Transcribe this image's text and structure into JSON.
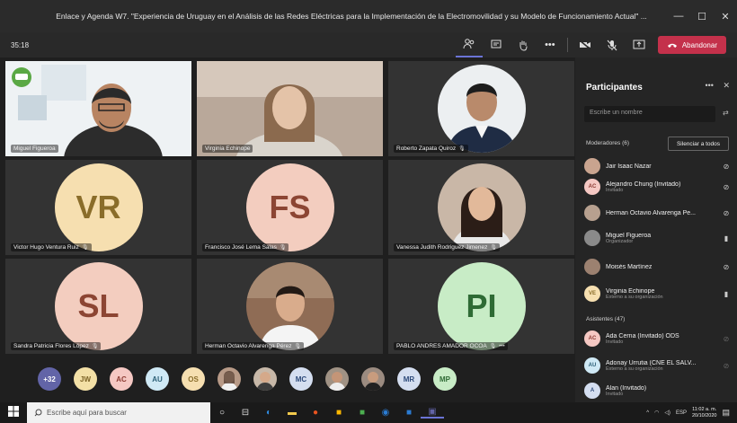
{
  "window": {
    "title": "Enlace y Agenda W7. \"Experiencia de Uruguay en el Análisis de las Redes Eléctricas para la Implementación de la Electromovilidad y su Modelo de Funcionamiento Actual\" ...",
    "minimize": "—",
    "maximize": "☐",
    "close": "✕"
  },
  "toolbar": {
    "timer": "35:18",
    "leave_label": "Abandonar"
  },
  "tiles": [
    {
      "name": "Miguel Figueroa",
      "initials": "",
      "color": "",
      "mic": false
    },
    {
      "name": "Virginia Echinope",
      "initials": "",
      "color": "",
      "mic": false
    },
    {
      "name": "Roberto Zapata Quiroz",
      "initials": "",
      "color": "",
      "mic": true
    },
    {
      "name": "Victor Hugo Ventura Ruiz",
      "initials": "VR",
      "color": "#f6dfb0",
      "mic": true
    },
    {
      "name": "Francisco José Lema Salas",
      "initials": "FS",
      "color": "#f3cdbf",
      "mic": true
    },
    {
      "name": "Vanessa Judith Rodriguez Jimenez",
      "initials": "",
      "color": "",
      "mic": true
    },
    {
      "name": "Sandra Patricia Flores López",
      "initials": "SL",
      "color": "#f3cdbf",
      "mic": true
    },
    {
      "name": "Herman Octavio Alvarenga Pérez",
      "initials": "",
      "color": "",
      "mic": true
    },
    {
      "name": "PABLO ANDRES AMADOR OCOA",
      "initials": "PI",
      "color": "#c8ecc6",
      "mic": true
    }
  ],
  "strip": {
    "overflow": "+32",
    "chips": [
      {
        "label": "JW",
        "color": "#f3e0a6"
      },
      {
        "label": "AC",
        "color": "#f5c8c3"
      },
      {
        "label": "AU",
        "color": "#cfe9f5"
      },
      {
        "label": "OS",
        "color": "#f6dfb0"
      },
      {
        "label": "",
        "color": "#b89a87"
      },
      {
        "label": "",
        "color": "#c7b8a8"
      },
      {
        "label": "MC",
        "color": "#d4def0"
      },
      {
        "label": "",
        "color": "#a09284"
      },
      {
        "label": "",
        "color": "#9b8b80"
      },
      {
        "label": "MR",
        "color": "#d4def0"
      },
      {
        "label": "MP",
        "color": "#c8ecc6"
      }
    ]
  },
  "panel": {
    "title": "Participantes",
    "more": "•••",
    "close": "✕",
    "search_placeholder": "Escribe un nombre",
    "moderators_heading": "Moderadores (6)",
    "mute_all": "Silenciar a todos",
    "attendees_heading": "Asistentes (47)",
    "participants": [
      {
        "name": "Jair Isaac Nazar",
        "role": "",
        "initials": "",
        "color": "#c9a48f"
      },
      {
        "name": "Alejandro Chung (Invitado)",
        "role": "Invitado",
        "initials": "AC",
        "color": "#f5c8c3"
      },
      {
        "name": "Herman Octavio Alvarenga Pe...",
        "role": "",
        "initials": "",
        "color": "#b7a08f"
      },
      {
        "name": "Miguel Figueroa",
        "role": "Organizador",
        "initials": "",
        "color": "#8a8a8a"
      },
      {
        "name": "Moisés Martínez",
        "role": "",
        "initials": "",
        "color": "#9c8170"
      },
      {
        "name": "Virginia Echinope",
        "role": "Externo a su organización",
        "initials": "VE",
        "color": "#f6dfb0"
      },
      {
        "name": "Ada Cerna (Invitado) ODS",
        "role": "Invitado",
        "initials": "AC",
        "color": "#f5c8c3"
      },
      {
        "name": "Adonay Urrutia (CNE EL SALV...",
        "role": "Externo a su organización",
        "initials": "AU",
        "color": "#cfe9f5"
      },
      {
        "name": "Alan (Invitado)",
        "role": "Invitado",
        "initials": "A",
        "color": "#d4def0"
      }
    ]
  },
  "taskbar": {
    "search_placeholder": "Escribe aquí para buscar",
    "lang": "ESP",
    "time": "11:02 a. m.",
    "date": "20/10/2020"
  }
}
